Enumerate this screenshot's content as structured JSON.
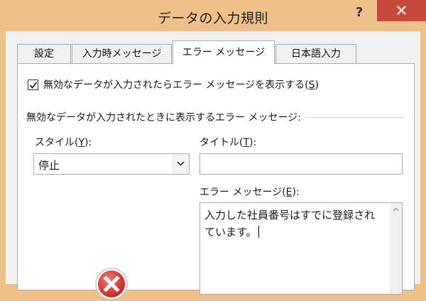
{
  "window": {
    "title": "データの入力規則",
    "help_label": "?"
  },
  "tabs": [
    {
      "label": "設定",
      "active": false
    },
    {
      "label": "入力時メッセージ",
      "active": false
    },
    {
      "label": "エラー メッセージ",
      "active": true
    },
    {
      "label": "日本語入力",
      "active": false
    }
  ],
  "error_tab": {
    "show_error_checkbox": {
      "checked": true,
      "label": "無効なデータが入力されたらエラー メッセージを表示する(",
      "hotkey": "S",
      "suffix": ")"
    },
    "section_label": "無効なデータが入力されたときに表示するエラー メッセージ:",
    "style": {
      "label_prefix": "スタイル(",
      "hotkey": "Y",
      "label_suffix": "):",
      "value": "停止",
      "icon": "error-stop-icon"
    },
    "title_field": {
      "label_prefix": "タイトル(",
      "hotkey": "T",
      "label_suffix": "):",
      "value": ""
    },
    "message_field": {
      "label_prefix": "エラー メッセージ(",
      "hotkey": "E",
      "label_suffix": "):",
      "value": "入力した社員番号はすでに登録されています。"
    }
  },
  "colors": {
    "titlebar": "#f0c08a",
    "close_button": "#c7483d",
    "error_icon": "#d0342c"
  }
}
